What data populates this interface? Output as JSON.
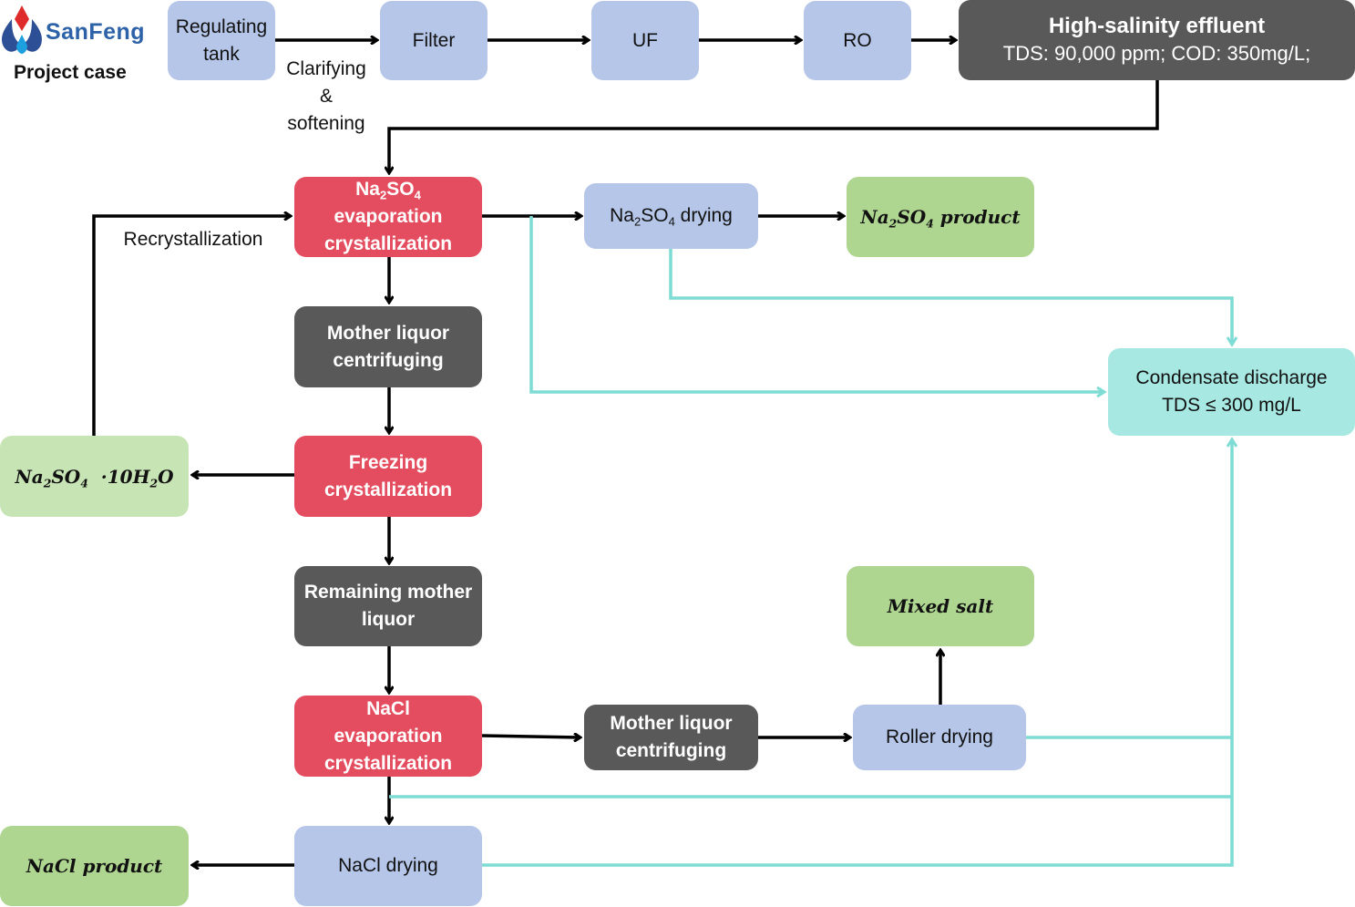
{
  "header": {
    "brand": "SanFeng",
    "subtitle": "Project case",
    "logo_icon": "sanfeng-droplet-logo"
  },
  "colors": {
    "pretreatment": "#b5c6e8",
    "crystallization": "#e44d5f",
    "mother_liquor": "#595959",
    "product": "#aed690",
    "byproduct": "#c7e4b4",
    "condensate": "#a8e8e2",
    "main_flow": "#000000",
    "condensate_flow": "#7fdcd4"
  },
  "nodes": {
    "regulating_tank": {
      "line1": "Regulating",
      "line2": "tank"
    },
    "filter": {
      "label": "Filter"
    },
    "uf": {
      "label": "UF"
    },
    "ro": {
      "label": "RO"
    },
    "effluent": {
      "title": "High-salinity effluent",
      "spec": "TDS: 90,000 ppm; COD: 350mg/L;"
    },
    "na2so4_evap": {
      "formula": "Na",
      "sub1": "2",
      "mid": "SO",
      "sub2": "4",
      "line2": "evaporation",
      "line3": "crystallization"
    },
    "na2so4_drying": {
      "formula": "Na",
      "sub1": "2",
      "mid": "SO",
      "sub2": "4",
      "suffix": " drying"
    },
    "na2so4_product": {
      "formula": "Na",
      "sub1": "2",
      "mid": "SO",
      "sub2": "4",
      "suffix": " product"
    },
    "mother_liquor_1": {
      "line1": "Mother liquor",
      "line2": "centrifuging"
    },
    "freezing": {
      "line1": "Freezing",
      "line2": "crystallization"
    },
    "decahydrate": {
      "formula": "Na",
      "sub1": "2",
      "mid": "SO",
      "sub2": "4",
      "mid2": "  ·10H",
      "sub3": "2",
      "end": "O"
    },
    "remaining_mother": {
      "line1": "Remaining mother",
      "line2": "liquor"
    },
    "nacl_evap": {
      "line1": "NaCl",
      "line2": "evaporation",
      "line3": "crystallization"
    },
    "mother_liquor_2": {
      "line1": "Mother liquor",
      "line2": "centrifuging"
    },
    "roller_drying": {
      "label": "Roller drying"
    },
    "mixed_salt": {
      "label": "Mixed salt"
    },
    "nacl_drying": {
      "label": "NaCl drying"
    },
    "nacl_product": {
      "label": "NaCl product"
    },
    "condensate": {
      "line1": "Condensate discharge",
      "line2": "TDS ≤ 300 mg/L"
    }
  },
  "edge_labels": {
    "clarifying": [
      "Clarifying",
      "&",
      "softening"
    ],
    "recrystallization": "Recrystallization"
  }
}
